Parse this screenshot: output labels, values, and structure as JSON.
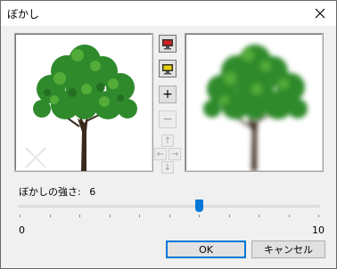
{
  "window": {
    "title": "ぼかし",
    "close_icon": "close-icon"
  },
  "controls": {
    "original_icon": "monitor-red-icon",
    "preview_icon": "monitor-yellow-icon",
    "zoom_in_label": "+",
    "zoom_out_label": "−",
    "arrow_up": "↑",
    "arrow_left": "←",
    "arrow_right": "→",
    "arrow_down": "↓"
  },
  "strength": {
    "label": "ぼかしの強さ:",
    "value": "6",
    "min": "0",
    "max": "10",
    "level": 6
  },
  "buttons": {
    "ok": "OK",
    "cancel": "キャンセル"
  },
  "colors": {
    "accent": "#0078d7",
    "tree_green": "#2e8b2e"
  }
}
